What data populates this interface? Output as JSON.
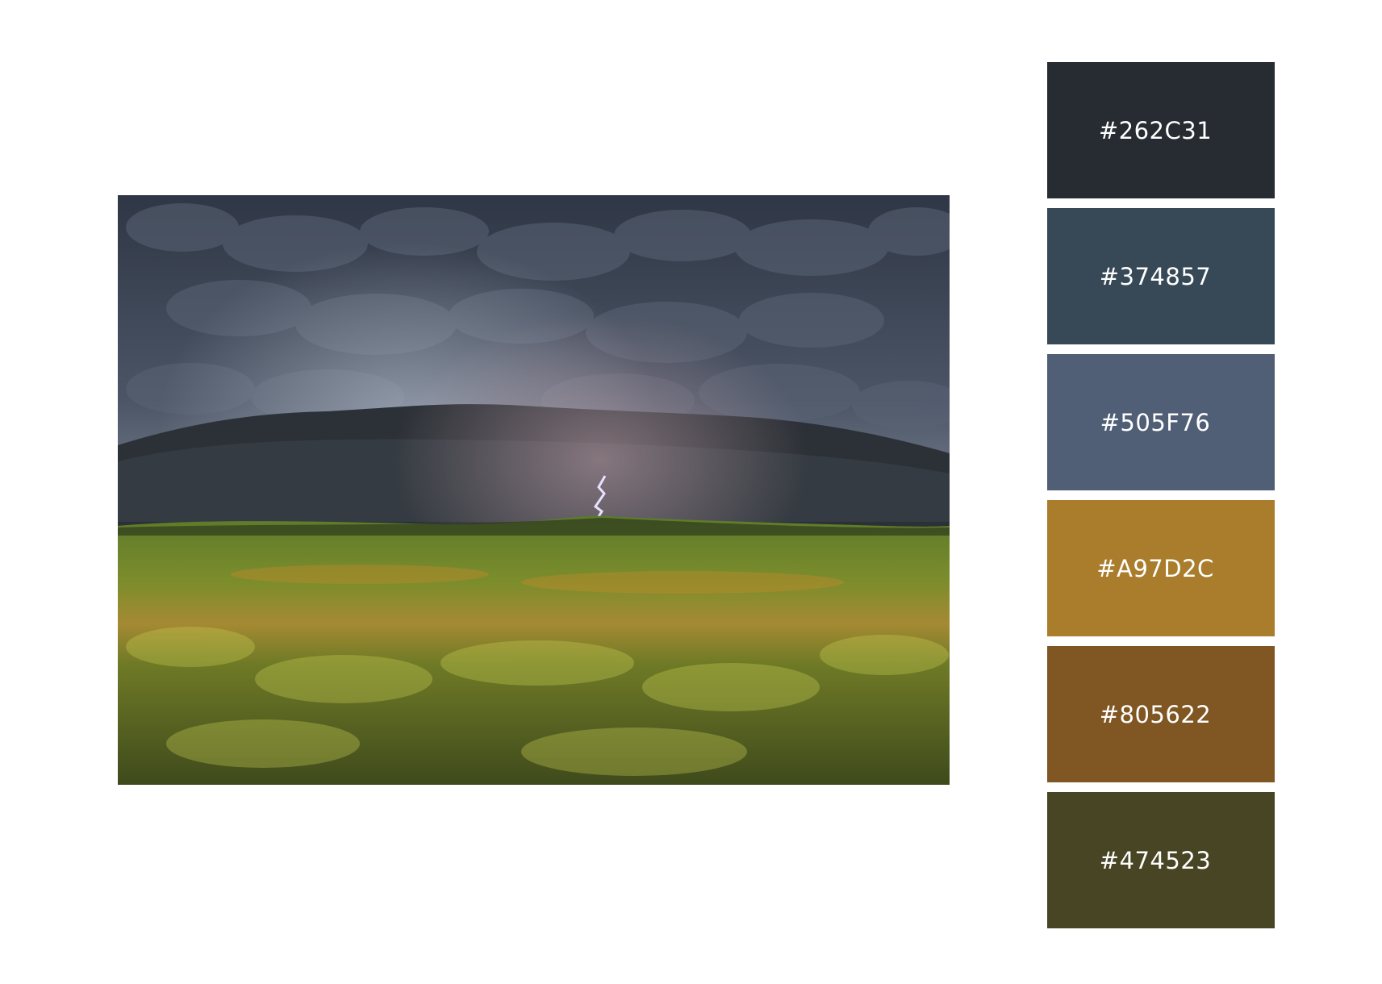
{
  "photo": {
    "icon": "storm-landscape-photo"
  },
  "palette": {
    "swatches": [
      {
        "label": "#262C31",
        "color": "#262C31"
      },
      {
        "label": "#374857",
        "color": "#374857"
      },
      {
        "label": "#505F76",
        "color": "#505F76"
      },
      {
        "label": "#A97D2C",
        "color": "#A97D2C"
      },
      {
        "label": "#805622",
        "color": "#805622"
      },
      {
        "label": "#474523",
        "color": "#474523"
      }
    ]
  }
}
